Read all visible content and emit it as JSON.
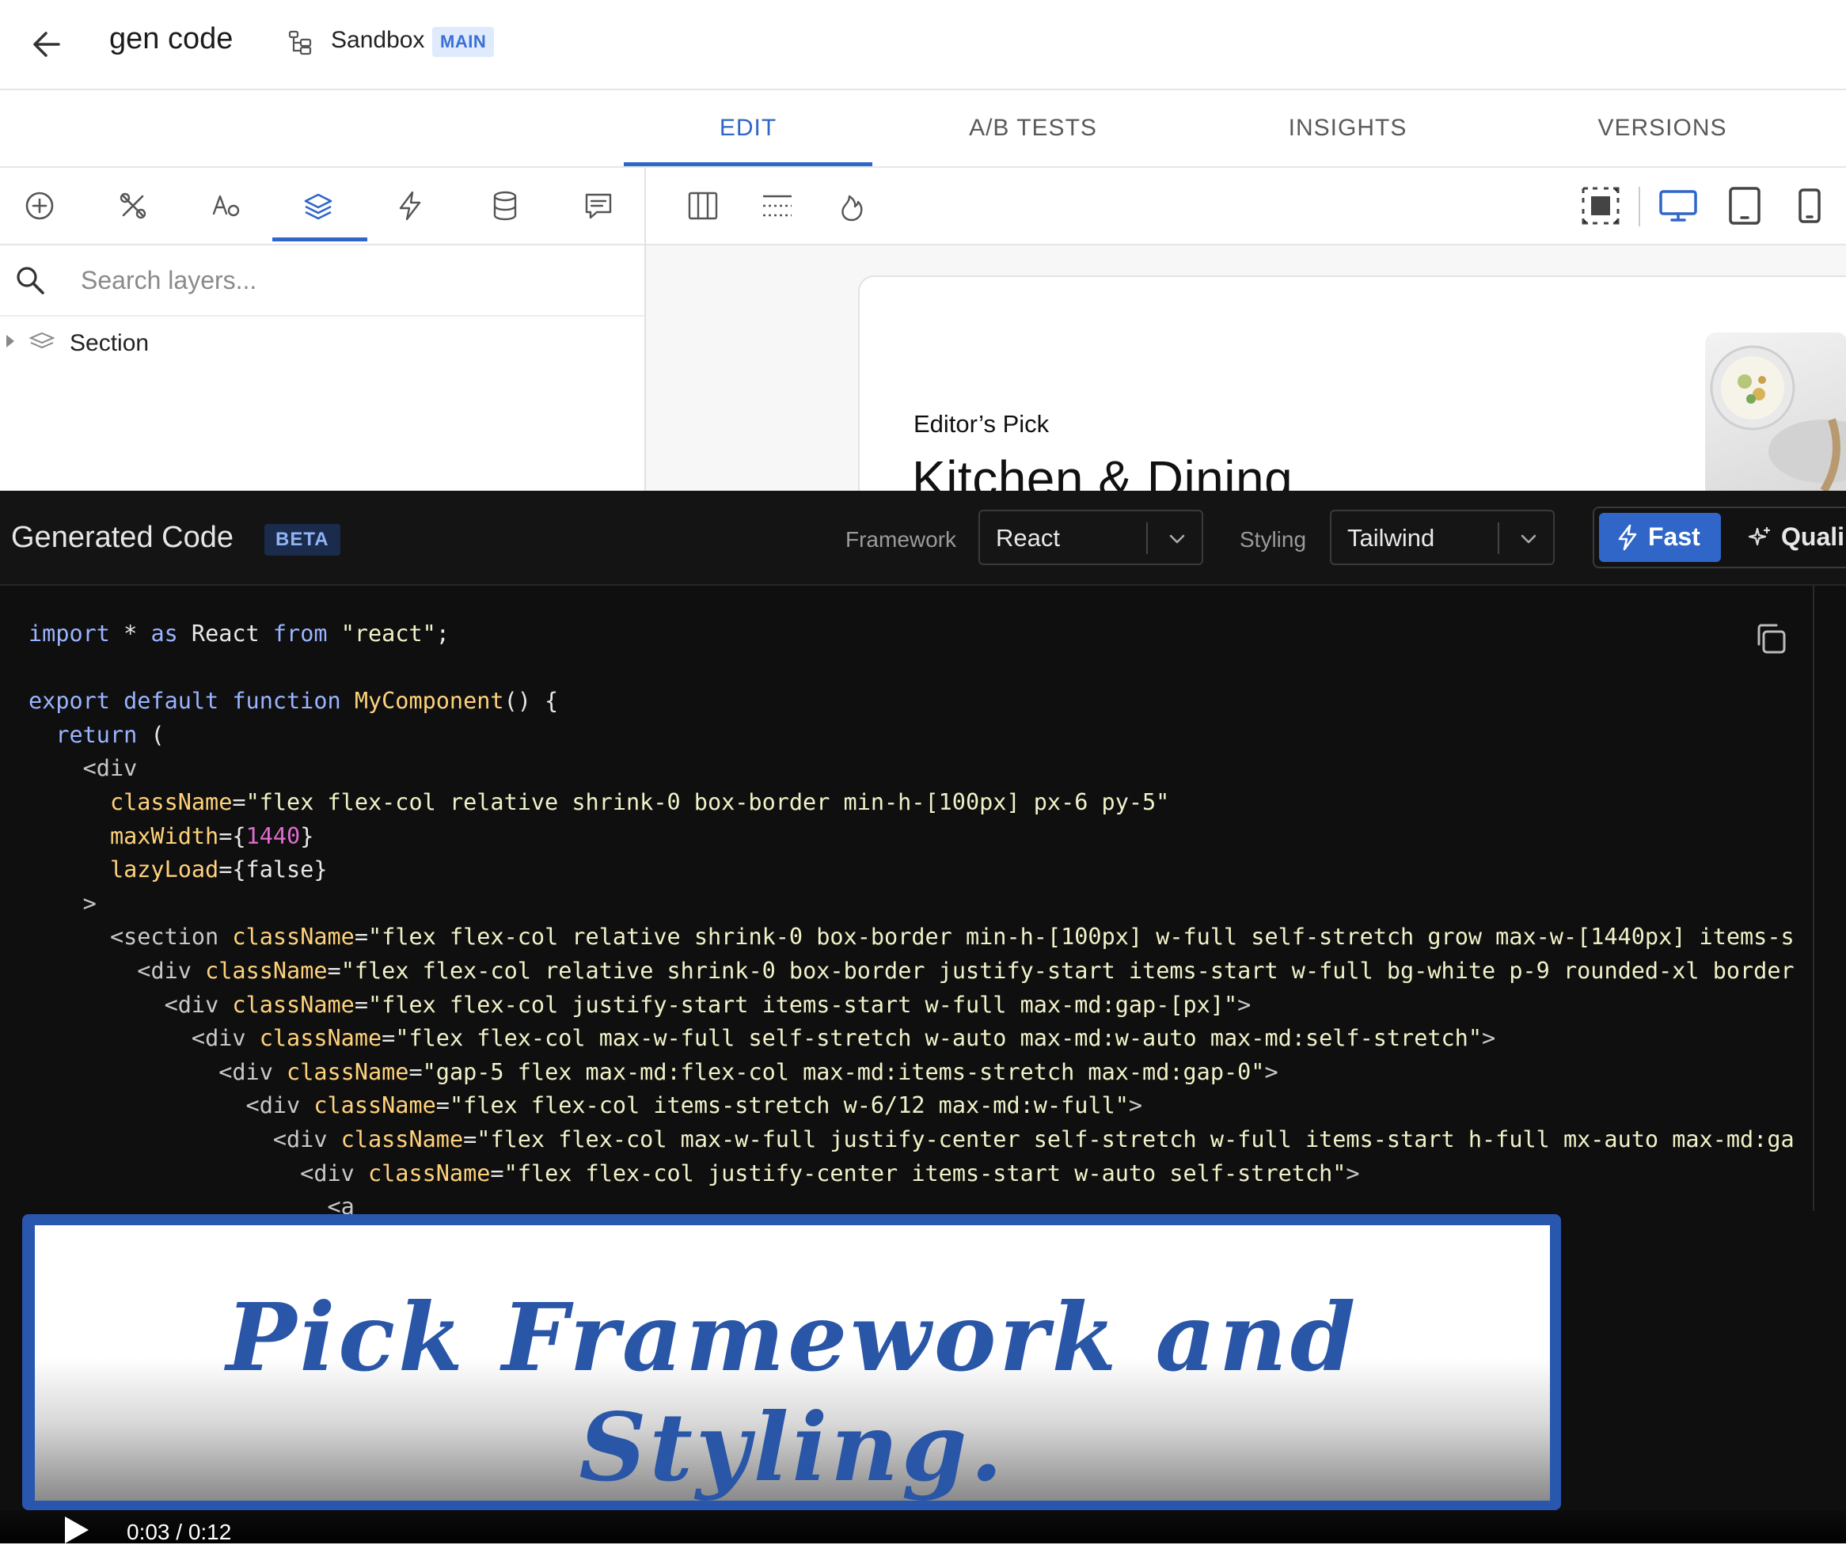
{
  "header": {
    "title": "gen code",
    "branch": "Sandbox",
    "branch_badge": "MAIN"
  },
  "tabs": [
    {
      "label": "EDIT",
      "active": true
    },
    {
      "label": "A/B TESTS",
      "active": false
    },
    {
      "label": "INSIGHTS",
      "active": false
    },
    {
      "label": "VERSIONS",
      "active": false
    }
  ],
  "toolbar": {
    "left_icons": [
      "add-circle-icon",
      "tools-icon",
      "typography-icon",
      "layers-icon",
      "lightning-icon",
      "database-icon",
      "comment-icon"
    ],
    "active_left": "layers-icon",
    "canvas_icons": [
      "columns-icon",
      "dotted-lines-icon",
      "flame-icon"
    ],
    "right_icons": [
      "select-frame-icon",
      "desktop-icon",
      "tablet-icon",
      "mobile-icon"
    ],
    "active_device": "desktop-icon"
  },
  "layers": {
    "search_placeholder": "Search layers...",
    "items": [
      {
        "label": "Section"
      }
    ]
  },
  "canvas": {
    "eyebrow": "Editor’s Pick",
    "headline": "Kitchen & Dining"
  },
  "code_panel": {
    "title": "Generated Code",
    "badge": "BETA",
    "framework_label": "Framework",
    "framework_value": "React",
    "styling_label": "Styling",
    "styling_value": "Tailwind",
    "mode_fast": "Fast",
    "mode_quality": "Quali"
  },
  "overlay": {
    "caption": "Pick Framework and Styling."
  },
  "player": {
    "time": "0:03 / 0:12"
  },
  "colors": {
    "accent": "#2f66c8",
    "panel_bg": "#0f0f10",
    "caption": "#2a56a8"
  }
}
